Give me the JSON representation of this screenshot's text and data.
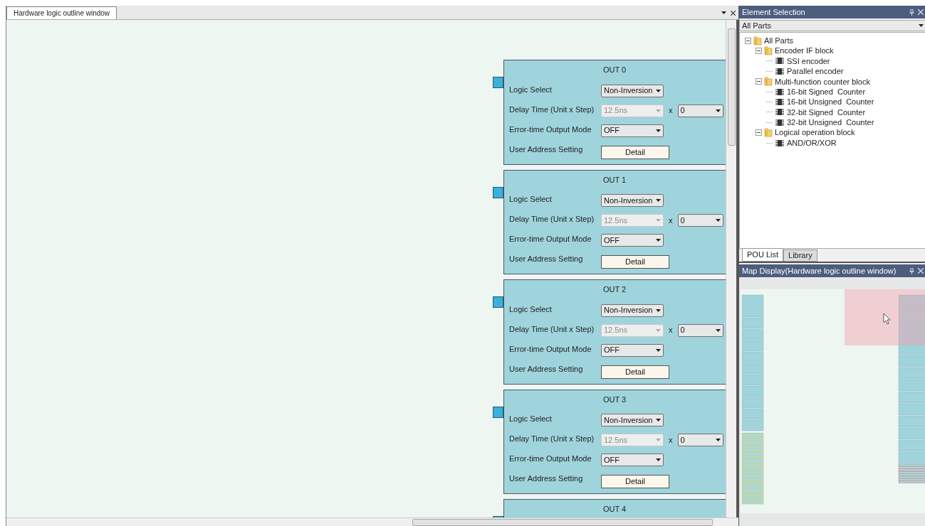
{
  "main_tab": {
    "label": "Hardware logic outline window",
    "selected": true
  },
  "blocks": [
    {
      "title": "OUT 0",
      "rows": [
        {
          "kind": "select",
          "label": "Logic Select",
          "value": "Non-Inversion",
          "disabled": false
        },
        {
          "kind": "delay",
          "label": "Delay Time (Unit x Step)",
          "unit": {
            "value": "12.5ns",
            "disabled": true
          },
          "times": "x",
          "step": {
            "value": "0",
            "disabled": false
          }
        },
        {
          "kind": "select",
          "label": "Error-time Output Mode",
          "value": "OFF",
          "disabled": false
        },
        {
          "kind": "button",
          "label": "User Address Setting",
          "button": "Detail"
        }
      ]
    },
    {
      "title": "OUT 1",
      "rows": [
        {
          "kind": "select",
          "label": "Logic Select",
          "value": "Non-Inversion",
          "disabled": false
        },
        {
          "kind": "delay",
          "label": "Delay Time (Unit x Step)",
          "unit": {
            "value": "12.5ns",
            "disabled": true
          },
          "times": "x",
          "step": {
            "value": "0",
            "disabled": false
          }
        },
        {
          "kind": "select",
          "label": "Error-time Output Mode",
          "value": "OFF",
          "disabled": false
        },
        {
          "kind": "button",
          "label": "User Address Setting",
          "button": "Detail"
        }
      ]
    },
    {
      "title": "OUT 2",
      "rows": [
        {
          "kind": "select",
          "label": "Logic Select",
          "value": "Non-Inversion",
          "disabled": false
        },
        {
          "kind": "delay",
          "label": "Delay Time (Unit x Step)",
          "unit": {
            "value": "12.5ns",
            "disabled": true
          },
          "times": "x",
          "step": {
            "value": "0",
            "disabled": false
          }
        },
        {
          "kind": "select",
          "label": "Error-time Output Mode",
          "value": "OFF",
          "disabled": false
        },
        {
          "kind": "button",
          "label": "User Address Setting",
          "button": "Detail"
        }
      ]
    },
    {
      "title": "OUT 3",
      "rows": [
        {
          "kind": "select",
          "label": "Logic Select",
          "value": "Non-Inversion",
          "disabled": false
        },
        {
          "kind": "delay",
          "label": "Delay Time (Unit x Step)",
          "unit": {
            "value": "12.5ns",
            "disabled": true
          },
          "times": "x",
          "step": {
            "value": "0",
            "disabled": false
          }
        },
        {
          "kind": "select",
          "label": "Error-time Output Mode",
          "value": "OFF",
          "disabled": false
        },
        {
          "kind": "button",
          "label": "User Address Setting",
          "button": "Detail"
        }
      ]
    },
    {
      "title": "OUT 4"
    }
  ],
  "element_selection": {
    "title": "Element Selection",
    "filter": "All Parts",
    "tree": [
      {
        "label": "All Parts",
        "kind": "folder",
        "expanded": true,
        "children": [
          {
            "label": "Encoder IF block",
            "kind": "folder",
            "expanded": true,
            "children": [
              {
                "label": "SSI encoder",
                "kind": "part"
              },
              {
                "label": "Parallel encoder",
                "kind": "part"
              }
            ]
          },
          {
            "label": "Multi-function counter block",
            "kind": "folder",
            "expanded": true,
            "children": [
              {
                "label": "16-bit Signed  Counter",
                "kind": "part"
              },
              {
                "label": "16-bit Unsigned  Counter",
                "kind": "part"
              },
              {
                "label": "32-bit Signed  Counter",
                "kind": "part"
              },
              {
                "label": "32-bit Unsigned  Counter",
                "kind": "part"
              }
            ]
          },
          {
            "label": "Logical operation block",
            "kind": "folder",
            "expanded": true,
            "children": [
              {
                "label": "AND/OR/XOR",
                "kind": "part"
              }
            ]
          }
        ]
      }
    ]
  },
  "bottom_tabs": [
    {
      "label": "POU List",
      "selected": true
    },
    {
      "label": "Library",
      "selected": false
    }
  ],
  "map_display": {
    "title": "Map Display(Hardware logic outline window)"
  }
}
